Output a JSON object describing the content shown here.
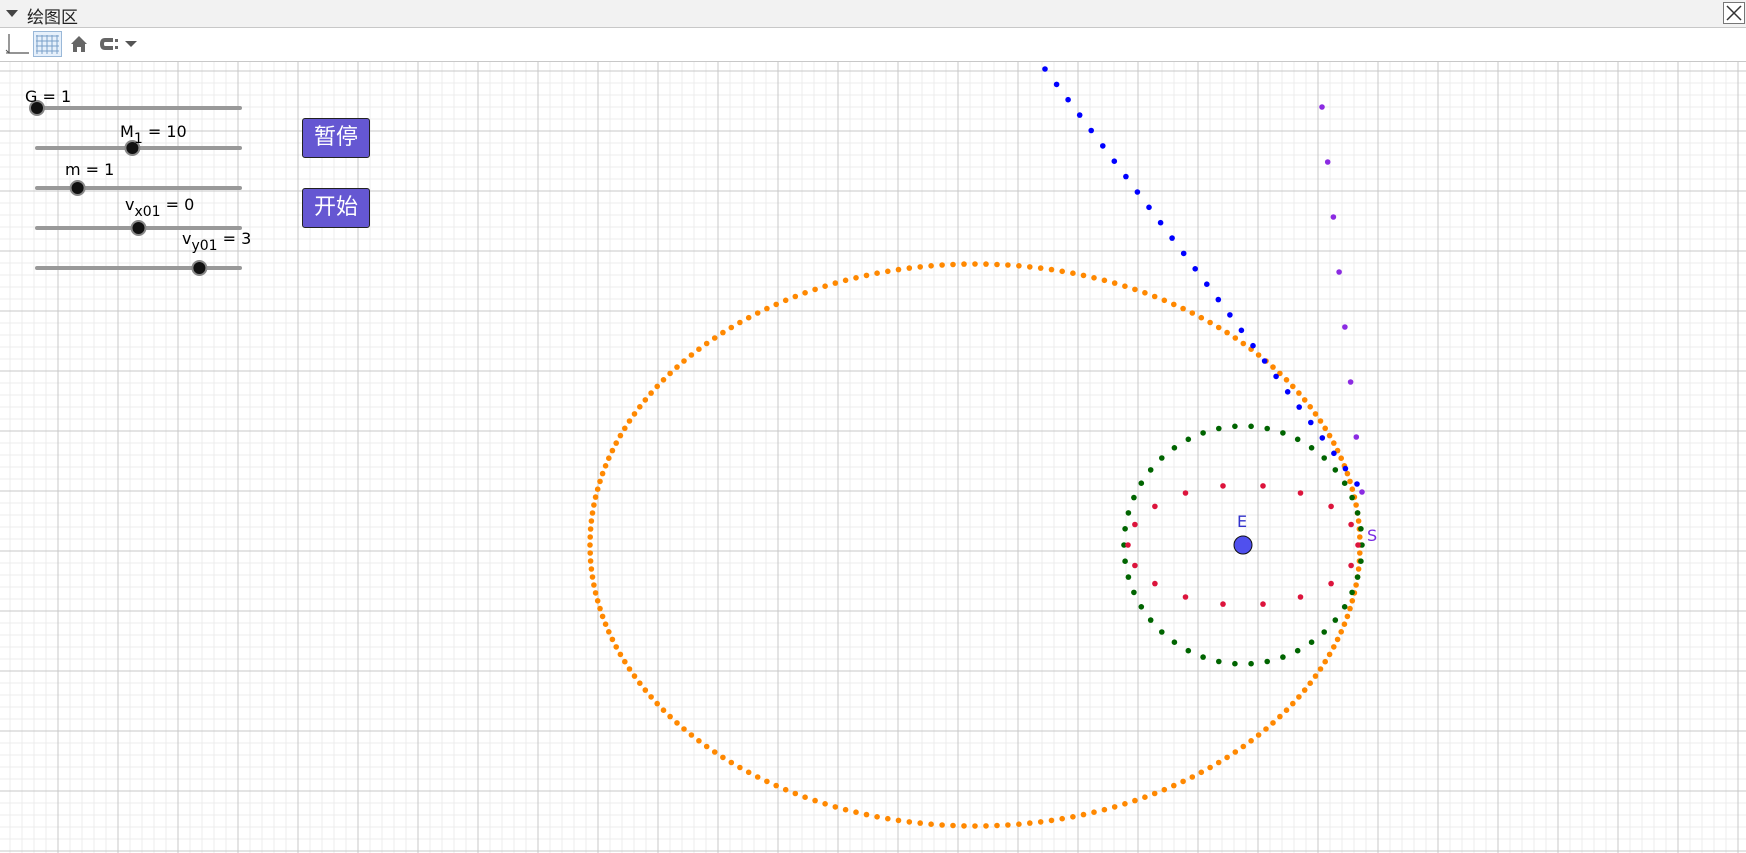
{
  "window": {
    "title": "绘图区"
  },
  "controls": {
    "g_label": "G = 1",
    "m1": {
      "var": "M",
      "sub": "1",
      "rest": " = 10"
    },
    "m_label": "m = 1",
    "vx01": {
      "var": "v",
      "sub": "x01",
      "rest": " = 0"
    },
    "vy01": {
      "var": "v",
      "sub": "y01",
      "rest": " = 3"
    },
    "pause_label": "暂停",
    "start_label": "开始"
  },
  "points": {
    "e_label": "E",
    "s_label": "S"
  },
  "slider_levels": {
    "g": 0.0,
    "m1": 0.47,
    "m": 0.2,
    "vx01": 0.5,
    "vy01": 0.8
  },
  "colors": {
    "button": "#6557d2",
    "earth": "#5050ee",
    "orange": "#ff8800",
    "green": "#006400",
    "red": "#dc143c",
    "blue": "#0000ff",
    "purple": "#8b2be2",
    "s_label": "#7a2be2",
    "e_label": "#3333cc"
  }
}
